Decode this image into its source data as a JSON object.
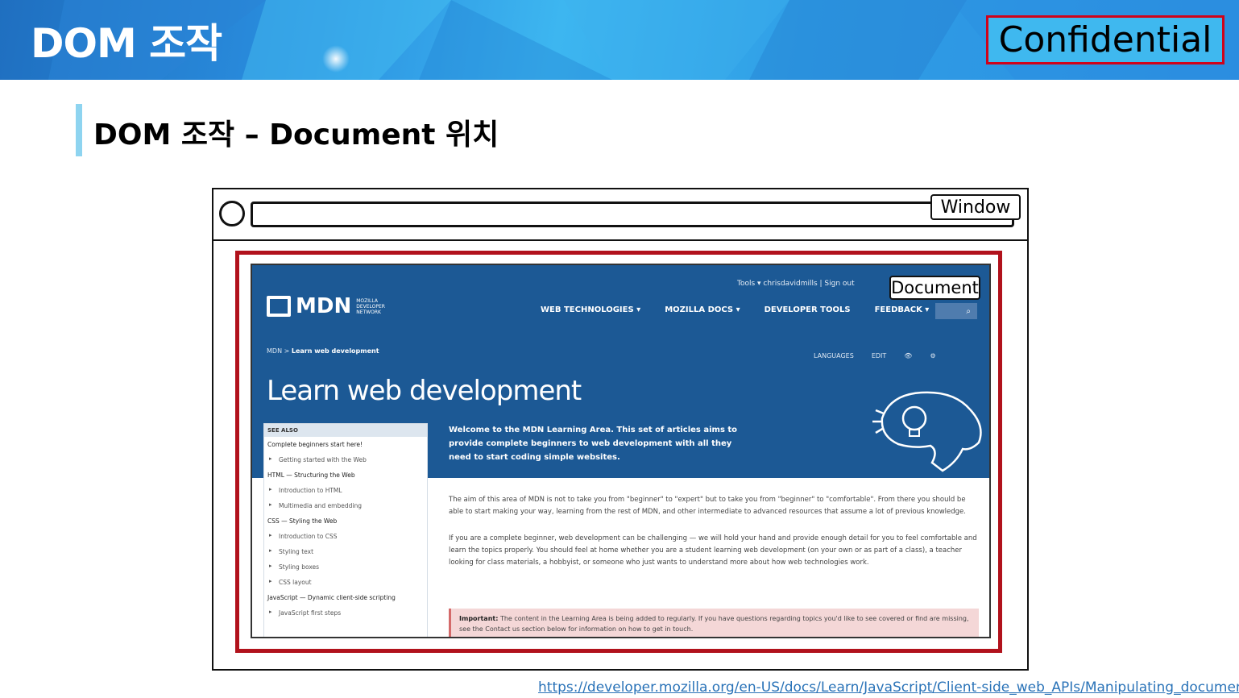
{
  "header": {
    "title": "DOM 조작",
    "confidential_label": "Confidential"
  },
  "section": {
    "title": "DOM 조작 – Document 위치"
  },
  "browser": {
    "window_label": "Window",
    "document_label": "Document"
  },
  "mdn": {
    "logo_text": "MDN",
    "logo_sub": "MOZILLA DEVELOPER NETWORK",
    "top_links": "Tools ▾    chrisdavidmills | Sign out",
    "nav": [
      "WEB TECHNOLOGIES ▾",
      "MOZILLA DOCS ▾",
      "DEVELOPER TOOLS",
      "FEEDBACK ▾"
    ],
    "breadcrumb_root": "MDN >",
    "breadcrumb_current": "Learn web development",
    "tools": [
      "LANGUAGES",
      "EDIT",
      "👁",
      "⚙"
    ],
    "heading": "Learn web development",
    "intro": "Welcome to the MDN Learning Area. This set of articles aims to provide complete beginners to web development with all they need to start coding simple websites.",
    "sidebar": {
      "see_also": "SEE ALSO",
      "entries": [
        {
          "kind": "sec",
          "text": "Complete beginners start here!"
        },
        {
          "kind": "item",
          "text": "Getting started with the Web"
        },
        {
          "kind": "sec",
          "text": "HTML — Structuring the Web"
        },
        {
          "kind": "item",
          "text": "Introduction to HTML"
        },
        {
          "kind": "item",
          "text": "Multimedia and embedding"
        },
        {
          "kind": "sec",
          "text": "CSS — Styling the Web"
        },
        {
          "kind": "item",
          "text": "Introduction to CSS"
        },
        {
          "kind": "item",
          "text": "Styling text"
        },
        {
          "kind": "item",
          "text": "Styling boxes"
        },
        {
          "kind": "item",
          "text": "CSS layout"
        },
        {
          "kind": "sec",
          "text": "JavaScript — Dynamic client-side scripting"
        },
        {
          "kind": "item",
          "text": "JavaScript first steps"
        }
      ]
    },
    "body_p1": "The aim of this area of MDN is not to take you from \"beginner\" to \"expert\" but to take you from \"beginner\" to \"comfortable\". From there you should be able to start making your way, learning from the rest of MDN, and other intermediate to advanced resources that assume a lot of previous knowledge.",
    "body_p2": "If you are a complete beginner, web development can be challenging — we will hold your hand and provide enough detail for you to feel comfortable and learn the topics properly. You should feel at home whether you are a student learning web development (on your own or as part of a class), a teacher looking for class materials, a hobbyist, or someone who just wants to understand more about how web technologies work.",
    "important_label": "Important:",
    "important_text": "The content in the Learning Area is being added to regularly. If you have questions regarding topics you'd like to see covered or find are missing, see the Contact us section below for information on how to get in touch."
  },
  "source_url": "https://developer.mozilla.org/en-US/docs/Learn/JavaScript/Client-side_web_APIs/Manipulating_documents"
}
